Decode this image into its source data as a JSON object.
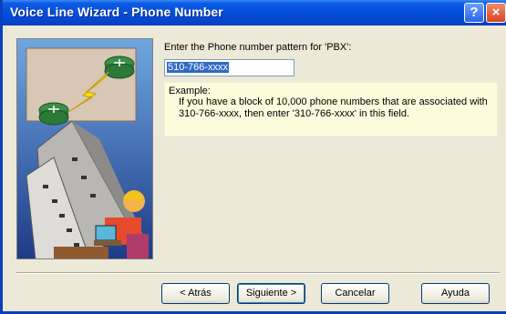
{
  "window": {
    "title": "Voice Line Wizard - Phone Number",
    "help_glyph": "?",
    "close_glyph": "×"
  },
  "form": {
    "prompt": "Enter the Phone number pattern for 'PBX':",
    "phone_pattern_value": "510-766-xxxx"
  },
  "example": {
    "title": "Example:",
    "text": "If you have a block of 10,000 phone numbers that are associated with 310-766-xxxx, then enter '310-766-xxxx' in this field."
  },
  "buttons": {
    "back": "< Atrás",
    "next": "Siguiente >",
    "cancel": "Cancelar",
    "help": "Ayuda"
  },
  "icons": {
    "illustration": "network-wizard-illustration",
    "help": "help-icon",
    "close": "close-icon"
  },
  "colors": {
    "titlebar": "#0550dd",
    "dialog_bg": "#ece9d8",
    "example_bg": "#fcfcdc",
    "selection": "#316ac5"
  }
}
